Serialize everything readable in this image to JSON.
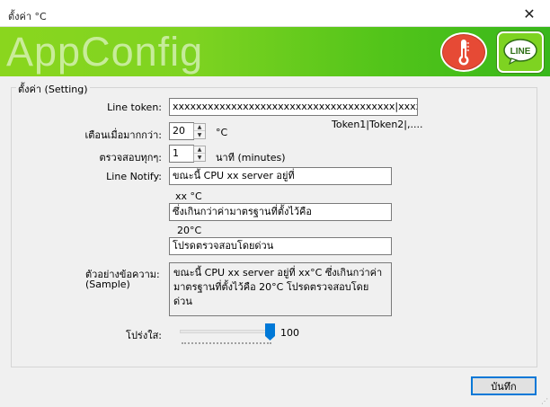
{
  "window": {
    "title": "ตั้งค่า °C",
    "close_glyph": "✕"
  },
  "banner": {
    "logo_text": "AppConfig",
    "line_badge": "LINE",
    "brand_green": "#7ed321",
    "thermo_red": "#e64a35"
  },
  "settings": {
    "group_title": "ตั้งค่า (Setting)",
    "line_token_label": "Line token:",
    "line_token_value": "xxxxxxxxxxxxxxxxxxxxxxxxxxxxxxxxxxxxxx|xxxxxxx....",
    "token_hint": "Token1|Token2|,....",
    "alert_label": "เตือนเมื่อมากกว่า:",
    "alert_value": "20",
    "alert_unit": "°C",
    "check_label": "ตรวจสอบทุกๆ:",
    "check_value": "1",
    "check_unit": "นาที (minutes)",
    "notify_label": "Line Notify:",
    "notify_line1": "ขณะนี้ CPU xx server อยู่ที่",
    "notify_hint1": "xx °C",
    "notify_line2": "ซึ่งเกินกว่าค่ามาตรฐานที่ตั้งไว้คือ",
    "notify_hint2": "20°C",
    "notify_line3": "โปรดตรวจสอบโดยด่วน",
    "sample_label_th": "ตัวอย่างข้อความ:",
    "sample_label_en": "(Sample)",
    "sample_text": "ขณะนี้ CPU xx server อยู่ที่ xx°C ซึ่งเกินกว่าค่ามาตรฐานที่ตั้งไว้คือ 20°C โปรดตรวจสอบโดยด่วน",
    "opacity_label": "โปร่งใส:",
    "opacity_value": "100",
    "opacity_level": 1.0
  },
  "footer": {
    "save_label": "บันทึก"
  }
}
